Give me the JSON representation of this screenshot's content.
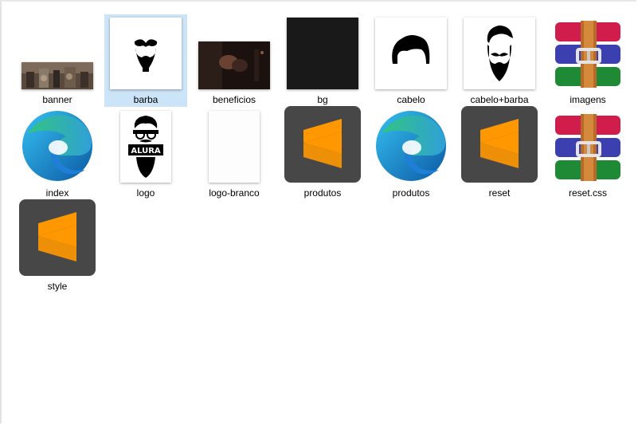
{
  "explorer": {
    "items": [
      {
        "label": "banner",
        "icon": "banner-photo-thumbnail"
      },
      {
        "label": "barba",
        "icon": "beard-silhouette-thumbnail",
        "selected": true
      },
      {
        "label": "beneficios",
        "icon": "barbershop-photo-thumbnail"
      },
      {
        "label": "bg",
        "icon": "dark-texture-thumbnail"
      },
      {
        "label": "cabelo",
        "icon": "hair-silhouette-thumbnail"
      },
      {
        "label": "cabelo+barba",
        "icon": "hair-beard-silhouette-thumbnail"
      },
      {
        "label": "imagens",
        "icon": "winrar-archive-icon"
      },
      {
        "label": "index",
        "icon": "edge-browser-icon"
      },
      {
        "label": "logo",
        "icon": "alura-logo-thumbnail"
      },
      {
        "label": "logo-branco",
        "icon": "white-logo-thumbnail"
      },
      {
        "label": "produtos",
        "icon": "sublime-text-icon"
      },
      {
        "label": "produtos",
        "icon": "edge-browser-icon"
      },
      {
        "label": "reset",
        "icon": "sublime-text-icon"
      },
      {
        "label": "reset.css",
        "icon": "winrar-archive-icon"
      },
      {
        "label": "style",
        "icon": "sublime-text-icon"
      }
    ],
    "logo_text": "ALURA",
    "colors": {
      "selection": "#cce4f7",
      "sublime_bg": "#474747",
      "sublime_orange": "#ff9800",
      "edge_blue": "#0c59a4",
      "edge_green": "#33c481"
    }
  }
}
